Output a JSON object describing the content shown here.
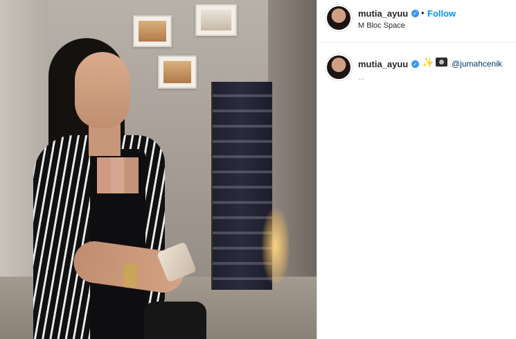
{
  "post": {
    "header": {
      "username": "mutia_ayuu",
      "verified_glyph": "✓",
      "separator": "•",
      "follow_label": "Follow",
      "location": "M Bloc Space"
    },
    "caption": {
      "username": "mutia_ayuu",
      "verified_glyph": "✓",
      "sparkle_glyph": "✨",
      "camera_icon": "camera-icon",
      "mention": "@jumahcenik",
      "more_text": "..."
    },
    "colors": {
      "follow_blue": "#0095f6",
      "verified_blue": "#3897f0",
      "mention_blue": "#00376b"
    }
  }
}
